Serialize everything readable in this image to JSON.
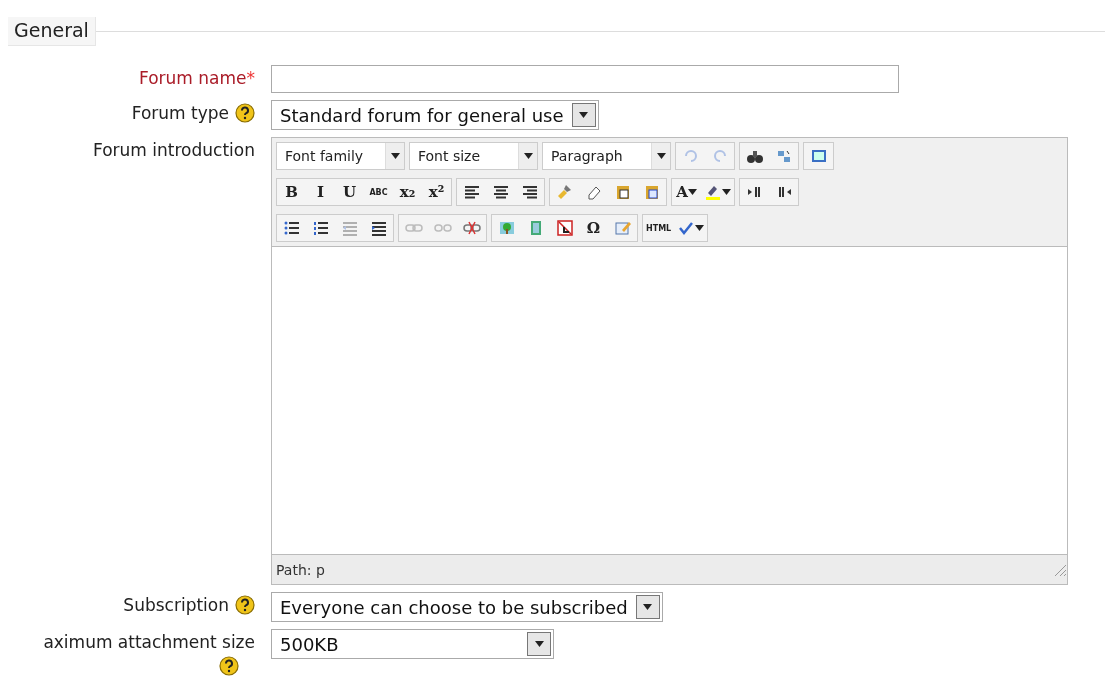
{
  "section": {
    "legend": "General"
  },
  "fields": [
    {
      "kind": "text",
      "label": "Forum name",
      "required_mark": "*",
      "help": false
    },
    {
      "kind": "select",
      "label": "Forum type",
      "help": true,
      "value": "Standard forum for general use"
    },
    {
      "kind": "editor",
      "label": "Forum introduction",
      "help": false
    },
    {
      "kind": "select",
      "label": "Subscription",
      "help": true,
      "value": "Everyone can choose to be subscribed"
    },
    {
      "kind": "select",
      "label": "aximum attachment size",
      "help": true,
      "help_below": true,
      "value": "500KB"
    }
  ],
  "editor": {
    "selects": [
      "Font family",
      "Font size",
      "Paragraph"
    ],
    "toolbar_rows": [
      [
        [
          {
            "kind": "undo",
            "disabled": true
          },
          {
            "kind": "redo",
            "disabled": true
          }
        ],
        [
          {
            "kind": "search",
            "disabled": false
          },
          {
            "kind": "replace",
            "disabled": false
          }
        ],
        [
          {
            "kind": "fullscreen",
            "disabled": false
          }
        ]
      ],
      [
        [
          {
            "kind": "bold",
            "glyph": "B",
            "disabled": false
          },
          {
            "kind": "italic",
            "glyph": "I",
            "disabled": false
          },
          {
            "kind": "underline",
            "glyph": "U",
            "disabled": false
          },
          {
            "kind": "strike",
            "glyph": "ABC",
            "disabled": false
          },
          {
            "kind": "sub",
            "glyph": "x₂",
            "disabled": false
          },
          {
            "kind": "sup",
            "glyph": "x²",
            "disabled": false
          }
        ],
        [
          {
            "kind": "align-left",
            "disabled": false
          },
          {
            "kind": "align-center",
            "disabled": false
          },
          {
            "kind": "align-right",
            "disabled": false
          }
        ],
        [
          {
            "kind": "brush",
            "disabled": false
          },
          {
            "kind": "eraser",
            "disabled": false
          },
          {
            "kind": "paste",
            "disabled": false
          },
          {
            "kind": "paste-word",
            "disabled": false
          }
        ],
        [
          {
            "kind": "forecolor",
            "glyph": "A",
            "dropdown": true,
            "disabled": false
          },
          {
            "kind": "backcolor",
            "dropdown": true,
            "disabled": false
          }
        ],
        [
          {
            "kind": "ltr",
            "disabled": false
          },
          {
            "kind": "rtl",
            "disabled": false
          }
        ]
      ],
      [
        [
          {
            "kind": "bullet-list",
            "disabled": false
          },
          {
            "kind": "number-list",
            "disabled": false
          },
          {
            "kind": "outdent",
            "disabled": true
          },
          {
            "kind": "indent",
            "disabled": false
          }
        ],
        [
          {
            "kind": "link",
            "disabled": true
          },
          {
            "kind": "unlink",
            "disabled": true
          },
          {
            "kind": "nolink",
            "disabled": false
          }
        ],
        [
          {
            "kind": "image",
            "disabled": false
          },
          {
            "kind": "media",
            "disabled": false
          },
          {
            "kind": "anchor",
            "disabled": false
          },
          {
            "kind": "charmap",
            "glyph": "Ω",
            "disabled": false
          },
          {
            "kind": "edit",
            "disabled": false
          }
        ],
        [
          {
            "kind": "html",
            "glyph": "HTML",
            "disabled": false
          },
          {
            "kind": "spell",
            "dropdown": true,
            "disabled": false
          }
        ]
      ]
    ],
    "path": "Path: p"
  }
}
